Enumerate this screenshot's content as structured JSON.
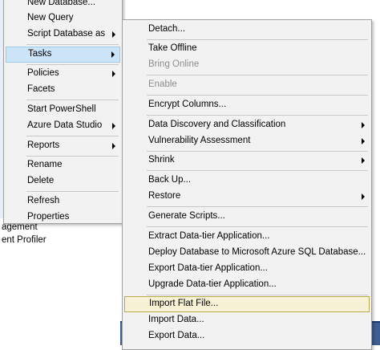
{
  "background": {
    "tree_lines": [
      "agement",
      "ent Profiler"
    ]
  },
  "main_menu": {
    "items": [
      {
        "label": "New Database...",
        "submenu": false
      },
      {
        "label": "New Query",
        "submenu": false
      },
      {
        "label": "Script Database as",
        "submenu": true
      },
      {
        "label": "Tasks",
        "submenu": true,
        "state": "active"
      },
      {
        "label": "Policies",
        "submenu": true
      },
      {
        "label": "Facets",
        "submenu": false
      },
      {
        "label": "Start PowerShell",
        "submenu": false
      },
      {
        "label": "Azure Data Studio",
        "submenu": true
      },
      {
        "label": "Reports",
        "submenu": true
      },
      {
        "label": "Rename",
        "submenu": false
      },
      {
        "label": "Delete",
        "submenu": false
      },
      {
        "label": "Refresh",
        "submenu": false
      },
      {
        "label": "Properties",
        "submenu": false
      }
    ]
  },
  "tasks_menu": {
    "items": [
      {
        "label": "Detach...",
        "submenu": false
      },
      {
        "label": "Take Offline",
        "submenu": false
      },
      {
        "label": "Bring Online",
        "submenu": false,
        "disabled": true
      },
      {
        "label": "Enable",
        "submenu": false,
        "disabled": true
      },
      {
        "label": "Encrypt Columns...",
        "submenu": false
      },
      {
        "label": "Data Discovery and Classification",
        "submenu": true
      },
      {
        "label": "Vulnerability Assessment",
        "submenu": true
      },
      {
        "label": "Shrink",
        "submenu": true
      },
      {
        "label": "Back Up...",
        "submenu": false
      },
      {
        "label": "Restore",
        "submenu": true
      },
      {
        "label": "Generate Scripts...",
        "submenu": false
      },
      {
        "label": "Extract Data-tier Application...",
        "submenu": false
      },
      {
        "label": "Deploy Database to Microsoft Azure SQL Database...",
        "submenu": false
      },
      {
        "label": "Export Data-tier Application...",
        "submenu": false
      },
      {
        "label": "Upgrade Data-tier Application...",
        "submenu": false
      },
      {
        "label": "Import Flat File...",
        "submenu": false,
        "state": "hover"
      },
      {
        "label": "Import Data...",
        "submenu": false
      },
      {
        "label": "Export Data...",
        "submenu": false
      }
    ]
  },
  "colors": {
    "menu_bg": "#f2f2f2",
    "active_bg": "#cce4f7",
    "hover_bg": "#f7f1d5",
    "disabled_text": "#8d8d8d"
  }
}
